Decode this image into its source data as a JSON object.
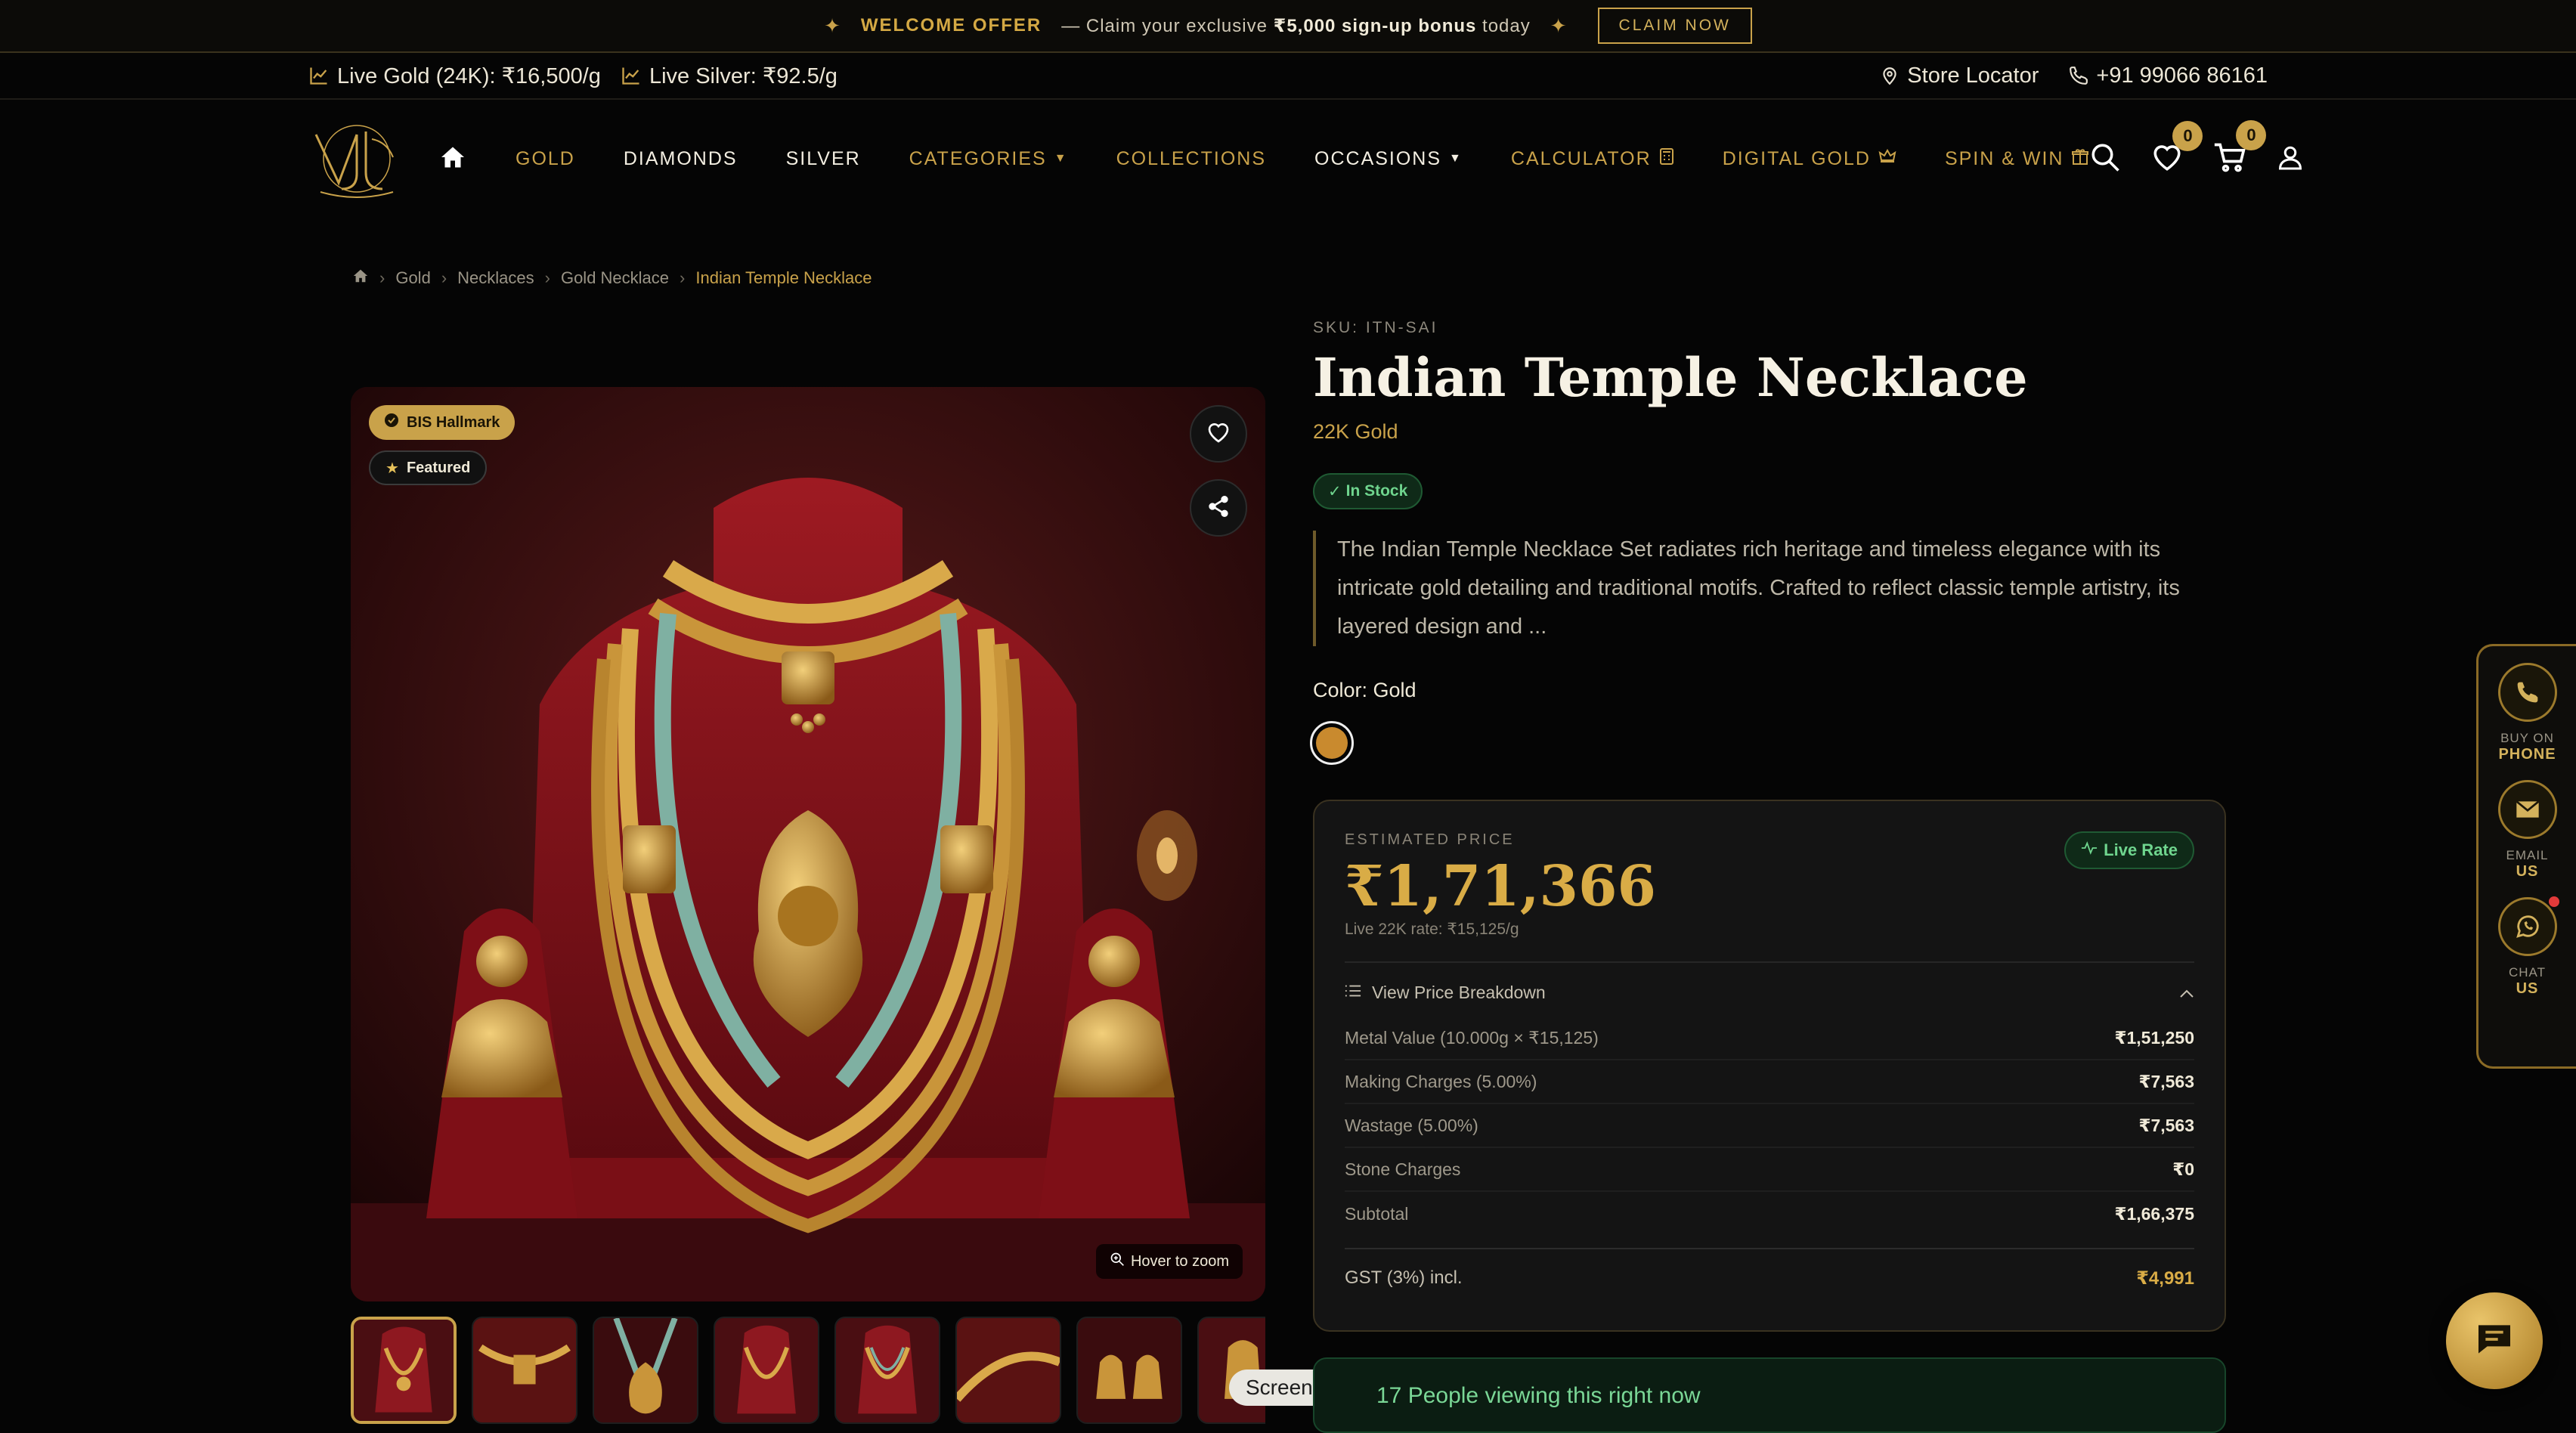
{
  "promo": {
    "offer_label": "WELCOME OFFER",
    "text_before": "— Claim your exclusive",
    "bonus": "₹5,000 sign-up bonus",
    "text_after": "today",
    "claim_button": "CLAIM NOW"
  },
  "rates": {
    "gold": "Live Gold (24K): ₹16,500/g",
    "silver": "Live Silver: ₹92.5/g",
    "store_locator": "Store Locator",
    "phone": "+91 99066 86161"
  },
  "nav": {
    "links": [
      "GOLD",
      "DIAMONDS",
      "SILVER",
      "CATEGORIES",
      "COLLECTIONS",
      "OCCASIONS",
      "CALCULATOR",
      "DIGITAL GOLD",
      "SPIN & WIN"
    ],
    "wishlist_count": "0",
    "cart_count": "0"
  },
  "breadcrumb": [
    "Gold",
    "Necklaces",
    "Gold Necklace",
    "Indian Temple Necklace"
  ],
  "gallery": {
    "badge_hallmark": "BIS Hallmark",
    "badge_featured": "Featured",
    "zoom_hint": "Hover to zoom",
    "thumbnail_count": 8
  },
  "tooltip": "Screenshot",
  "product": {
    "sku": "SKU: ITN-SAI",
    "title": "Indian Temple Necklace",
    "purity": "22K Gold",
    "stock": "In Stock",
    "description": "The Indian Temple Necklace Set radiates rich heritage and timeless elegance with its intricate gold detailing and traditional motifs. Crafted to reflect classic temple artistry, its layered design and ...",
    "color_label": "Color: Gold",
    "swatch_color": "#c98a2e"
  },
  "price": {
    "estimated_label": "ESTIMATED PRICE",
    "amount": "₹1,71,366",
    "live_rate": "Live 22K rate: ₹15,125/g",
    "live_badge": "Live Rate",
    "breakdown_label": "View Price Breakdown",
    "rows": [
      {
        "label": "Metal Value (10.000g × ₹15,125)",
        "value": "₹1,51,250"
      },
      {
        "label": "Making Charges (5.00%)",
        "value": "₹7,563"
      },
      {
        "label": "Wastage (5.00%)",
        "value": "₹7,563"
      },
      {
        "label": "Stone Charges",
        "value": "₹0"
      },
      {
        "label": "Subtotal",
        "value": "₹1,66,375"
      }
    ],
    "gst_label": "GST (3%) incl.",
    "gst_value": "₹4,991"
  },
  "viewers": "17 People viewing this right now",
  "dock": [
    {
      "line1": "BUY ON",
      "line2": "PHONE"
    },
    {
      "line1": "EMAIL",
      "line2": "US"
    },
    {
      "line1": "CHAT",
      "line2": "US"
    }
  ],
  "colors": {
    "accent_gold": "#c9a24a",
    "price_gold": "#d9ac46",
    "live_green": "#6fd58e"
  }
}
